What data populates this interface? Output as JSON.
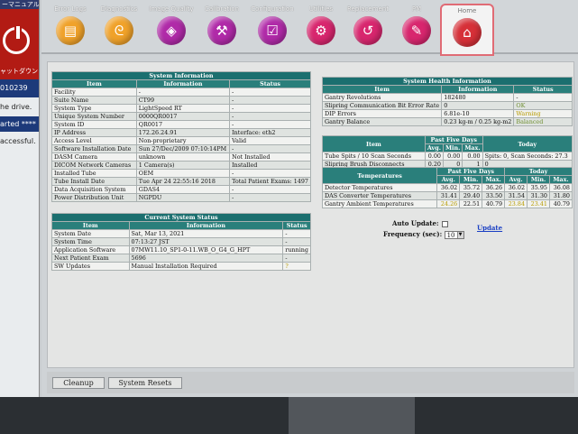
{
  "left_panel": {
    "banner": "ーマニュアル",
    "shutdown_label": "ャットダウン",
    "id_text": "010239",
    "lines": [
      "he drive.",
      "arted ****",
      "accessful."
    ]
  },
  "toolbar": {
    "items": [
      {
        "label": "Error Logs",
        "icon": "ledger-icon",
        "glyph": "▤"
      },
      {
        "label": "Diagnostics",
        "icon": "stethoscope-icon",
        "glyph": "ᘓ"
      },
      {
        "label": "Image Quality",
        "icon": "target-chart-icon",
        "glyph": "◈"
      },
      {
        "label": "Calibration",
        "icon": "hammer-icon",
        "glyph": "⚒"
      },
      {
        "label": "Configuration",
        "icon": "checklist-icon",
        "glyph": "☑"
      },
      {
        "label": "Utilities",
        "icon": "toolbox-icon",
        "glyph": "⚙"
      },
      {
        "label": "Replacement",
        "icon": "wrench-icon",
        "glyph": "↺"
      },
      {
        "label": "PM",
        "icon": "clipboard-icon",
        "glyph": "✎"
      },
      {
        "label": "Home",
        "icon": "home-icon",
        "glyph": "⌂"
      }
    ]
  },
  "system_information": {
    "title": "System Information",
    "headers": [
      "Item",
      "Information",
      "Status"
    ],
    "rows": [
      [
        "Facility",
        "-",
        "-"
      ],
      [
        "Suite Name",
        "CT99",
        "-"
      ],
      [
        "System Type",
        "LightSpeed RT",
        "-"
      ],
      [
        "Unique System Number",
        "0000QR0017",
        "-"
      ],
      [
        "System ID",
        "QR0017",
        "-"
      ],
      [
        "IP Address",
        "172.26.24.91",
        "Interface: eth2"
      ],
      [
        "Access Level",
        "Non-proprietary",
        "Valid"
      ],
      [
        "Software Installation Date",
        "Sun 27/Dec/2009 07:10:14PM",
        "-"
      ],
      [
        "DASM Camera",
        "unknown",
        "Not Installed"
      ],
      [
        "DICOM Network Cameras",
        "1 Camera(s)",
        "Installed"
      ],
      [
        "Installed Tube",
        "OEM",
        "-"
      ],
      [
        "Tube Install Date",
        "Tue Apr 24 22:55:16 2018",
        "Total Patient Exams: 1497"
      ],
      [
        "Data Acquisition System",
        "GDAS4",
        "-"
      ],
      [
        "Power Distribution Unit",
        "NGPDU",
        "-"
      ]
    ]
  },
  "current_status": {
    "title": "Current System Status",
    "headers": [
      "Item",
      "Information",
      "Status"
    ],
    "rows": [
      [
        "System Date",
        "Sat, Mar 13, 2021",
        "-"
      ],
      [
        "System Time",
        "07:13:27 JST",
        "-"
      ],
      [
        "Application Software",
        "07MW11.10_SP1-0-11.WB_O_G4_G_HPT",
        "running"
      ],
      [
        "Next Patient Exam",
        "5696",
        "-"
      ],
      [
        "SW Updates",
        "Manual Installation Required",
        "?"
      ]
    ]
  },
  "system_health": {
    "title": "System Health Information",
    "headers": [
      "Item",
      "Information",
      "Status"
    ],
    "rows": [
      [
        "Gantry Revolutions",
        "182480",
        "-"
      ],
      [
        "Slipring Communication Bit Error Rate",
        "0",
        "OK"
      ],
      [
        "DIP Errors",
        "6.81e-10",
        "Warning"
      ],
      [
        "Gantry Balance",
        "0.23 kg-m / 0.25 kg-m2",
        "Balanced"
      ]
    ]
  },
  "tube_spits": {
    "headers": [
      "Item",
      "Past Five Days",
      "Today"
    ],
    "sub_headers": [
      "Avg.",
      "Min.",
      "Max."
    ],
    "rows": [
      [
        "Tube Spits / 10 Scan Seconds",
        "0.00",
        "0.00",
        "0.00",
        "Spits: 0, Scan Seconds: 27.3"
      ],
      [
        "Slipring Brush Disconnects",
        "0.20",
        "0",
        "1",
        "0"
      ]
    ]
  },
  "temperatures": {
    "headers": [
      "Temperatures",
      "Past Five Days",
      "Today"
    ],
    "sub_headers": [
      "Avg.",
      "Min.",
      "Max.",
      "Avg.",
      "Min.",
      "Max."
    ],
    "rows": [
      [
        "Detector Temperatures",
        "36.02",
        "35.72",
        "36.26",
        "36.02",
        "35.95",
        "36.08"
      ],
      [
        "DAS Converter Temperatures",
        "31.41",
        "29.40",
        "33.50",
        "31.54",
        "31.30",
        "31.80"
      ],
      [
        "Gantry Ambient Temperatures",
        "24.26",
        "22.51",
        "40.79",
        "23.84",
        "23.41",
        "40.79"
      ]
    ]
  },
  "controls": {
    "auto_update_label": "Auto Update:",
    "frequency_label": "Frequency (sec):",
    "frequency_value": "10",
    "update_link": "Update"
  },
  "bottom": {
    "cleanup_label": "Cleanup",
    "resets_label": "System Resets"
  }
}
